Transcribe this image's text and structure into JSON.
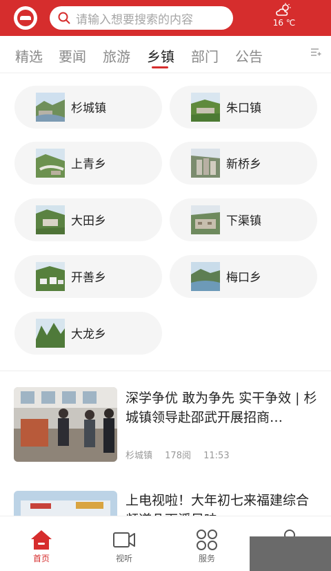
{
  "header": {
    "search_placeholder": "请输入想要搜索的内容",
    "weather": {
      "icon": "partly-cloudy-icon",
      "temperature": "16 ℃"
    },
    "brand_color": "#d62d2d"
  },
  "tabs": [
    {
      "label": "精选",
      "active": false
    },
    {
      "label": "要闻",
      "active": false
    },
    {
      "label": "旅游",
      "active": false
    },
    {
      "label": "乡镇",
      "active": true
    },
    {
      "label": "部门",
      "active": false
    },
    {
      "label": "公告",
      "active": false
    }
  ],
  "towns": [
    {
      "name": "杉城镇"
    },
    {
      "name": "朱口镇"
    },
    {
      "name": "上青乡"
    },
    {
      "name": "新桥乡"
    },
    {
      "name": "大田乡"
    },
    {
      "name": "下渠镇"
    },
    {
      "name": "开善乡"
    },
    {
      "name": "梅口乡"
    },
    {
      "name": "大龙乡"
    }
  ],
  "news": [
    {
      "title": "深学争优 敢为争先 实干争效 | 杉城镇领导赴邵武开展招商…",
      "source": "杉城镇",
      "reads": "178阅",
      "time": "11:53"
    },
    {
      "title": "上电视啦！大年初七来福建综合频道几下溪风味…"
    }
  ],
  "bottom_nav": [
    {
      "label": "首页",
      "icon": "home-icon",
      "active": true
    },
    {
      "label": "视听",
      "icon": "video-icon",
      "active": false
    },
    {
      "label": "服务",
      "icon": "grid-icon",
      "active": false
    },
    {
      "label": "",
      "icon": "user-icon",
      "active": false
    }
  ]
}
